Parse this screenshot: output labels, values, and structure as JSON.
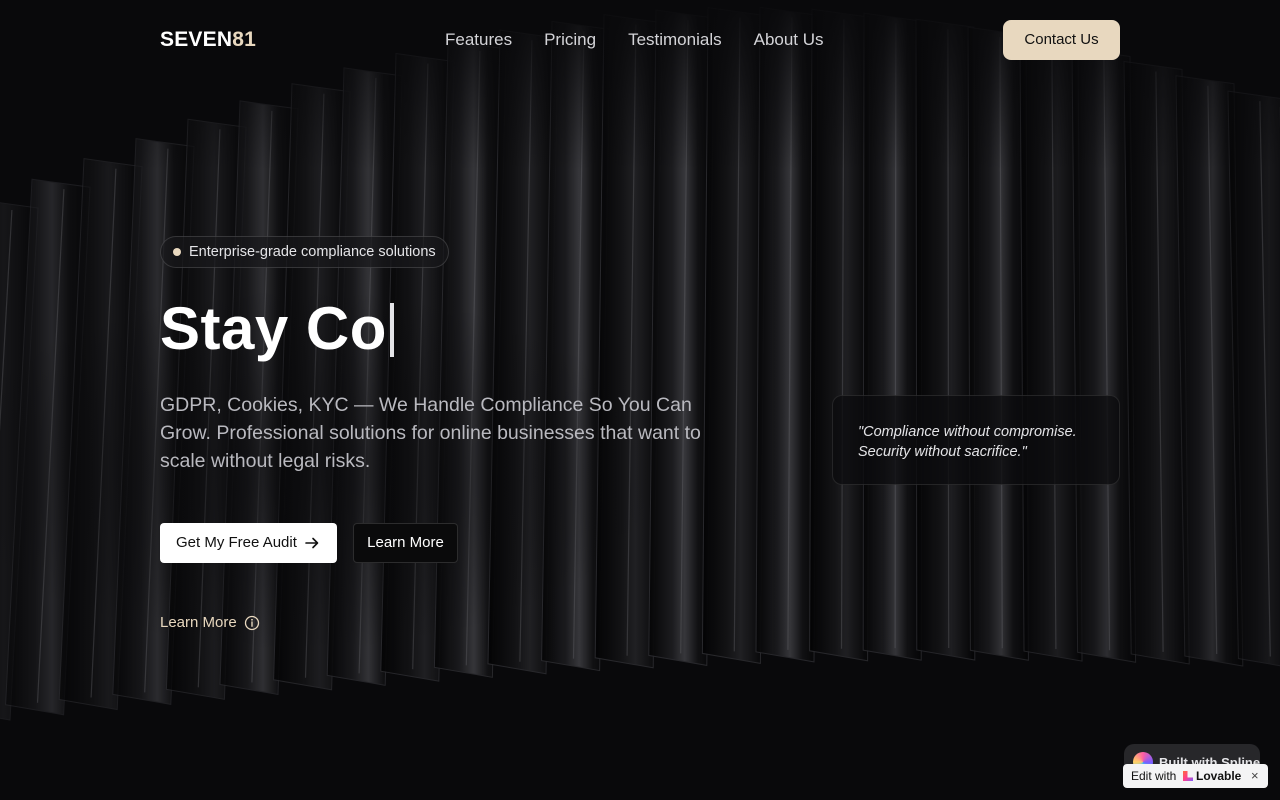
{
  "brand": {
    "name_main": "SEVEN",
    "name_accent": "81"
  },
  "nav": {
    "links": [
      "Features",
      "Pricing",
      "Testimonials",
      "About Us"
    ],
    "contact_label": "Contact Us"
  },
  "hero": {
    "badge": "Enterprise-grade compliance solutions",
    "headline": "Stay Co",
    "subtitle": "GDPR, Cookies, KYC — We Handle Compliance So You Can Grow. Professional solutions for online businesses that want to scale without legal risks.",
    "primary_cta": "Get My Free Audit",
    "secondary_cta": "Learn More",
    "link_label": "Learn More"
  },
  "quote": {
    "text": "\"Compliance without compromise. Security without sacrifice.\""
  },
  "widgets": {
    "spline": "Built with Spline",
    "lovable_edit": "Edit with",
    "lovable_name": "Lovable",
    "close": "×"
  },
  "colors": {
    "background": "#09090b",
    "accent": "#e8d8bf",
    "primary_button": "#ffffff"
  },
  "icons": [
    "arrow-right-icon",
    "info-icon",
    "spline-logo-icon",
    "lovable-heart-icon",
    "close-icon"
  ]
}
